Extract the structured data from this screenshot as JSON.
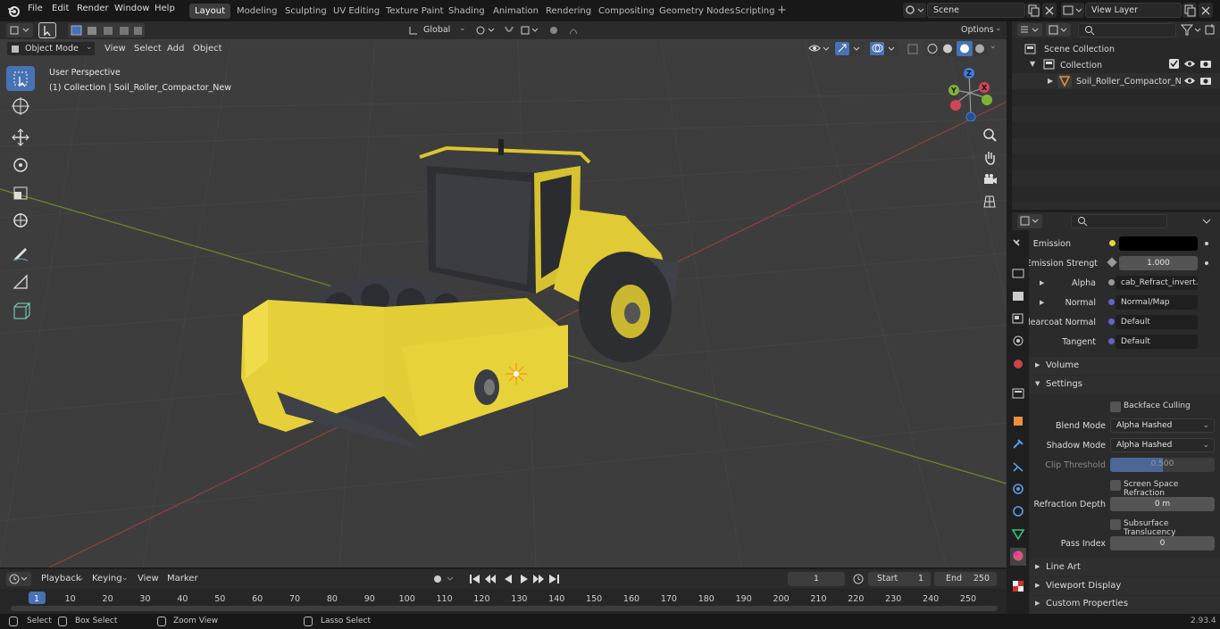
{
  "menubar": {
    "items": [
      "File",
      "Edit",
      "Render",
      "Window",
      "Help"
    ]
  },
  "workspaces": [
    "Layout",
    "Modeling",
    "Sculpting",
    "UV Editing",
    "Texture Paint",
    "Shading",
    "Animation",
    "Rendering",
    "Compositing",
    "Geometry Nodes",
    "Scripting"
  ],
  "active_workspace": "Layout",
  "scene": {
    "name": "Scene"
  },
  "view_layer": {
    "name": "View Layer"
  },
  "viewport_header": {
    "mode": "Object Mode",
    "menus": [
      "View",
      "Select",
      "Add",
      "Object"
    ],
    "transform_orientation": "Global",
    "options": "Options"
  },
  "viewport": {
    "overlay_line1": "User Perspective",
    "overlay_line2": "(1) Collection | Soil_Roller_Compactor_New",
    "gizmo": {
      "x": "X",
      "y": "Y",
      "z": "Z"
    }
  },
  "outliner": {
    "scene_collection": "Scene Collection",
    "collection": "Collection",
    "object": "Soil_Roller_Compactor_N"
  },
  "properties": {
    "rows": [
      {
        "label": "Emission",
        "value": "",
        "kind": "color"
      },
      {
        "label": "Emission Strengt",
        "value": "1.000",
        "kind": "number"
      },
      {
        "label": "Alpha",
        "value": "cab_Refract_invert.p...",
        "kind": "link"
      },
      {
        "label": "Normal",
        "value": "Normal/Map",
        "kind": "link"
      },
      {
        "label": "Clearcoat Normal",
        "value": "Default",
        "kind": "link"
      },
      {
        "label": "Tangent",
        "value": "Default",
        "kind": "link"
      }
    ],
    "sections": {
      "volume": "Volume",
      "settings": "Settings",
      "line_art": "Line Art",
      "viewport_display": "Viewport Display",
      "custom_properties": "Custom Properties"
    },
    "settings": {
      "backface_culling": "Backface Culling",
      "blend_mode_label": "Blend Mode",
      "blend_mode": "Alpha Hashed",
      "shadow_mode_label": "Shadow Mode",
      "shadow_mode": "Alpha Hashed",
      "clip_threshold_label": "Clip Threshold",
      "clip_threshold": "0.500",
      "screen_space_refraction": "Screen Space Refraction",
      "refraction_depth_label": "Refraction Depth",
      "refraction_depth": "0 m",
      "subsurface_translucency": "Subsurface Translucency",
      "pass_index_label": "Pass Index",
      "pass_index": "0"
    }
  },
  "timeline": {
    "menus": [
      "Playback",
      "Keying",
      "View",
      "Marker"
    ],
    "current_frame": "1",
    "start_label": "Start",
    "start": "1",
    "end_label": "End",
    "end": "250",
    "ruler": [
      "1",
      "10",
      "20",
      "30",
      "40",
      "50",
      "60",
      "70",
      "80",
      "90",
      "100",
      "110",
      "120",
      "130",
      "140",
      "150",
      "160",
      "170",
      "180",
      "190",
      "200",
      "210",
      "220",
      "230",
      "240",
      "250"
    ]
  },
  "statusbar": {
    "select": "Select",
    "box_select": "Box Select",
    "zoom_view": "Zoom View",
    "lasso_select": "Lasso Select",
    "version": "2.93.4"
  },
  "colors": {
    "accent": "#4772b3",
    "machine_yellow": "#e8d23a",
    "x_axis": "#d04455",
    "y_axis": "#7fb236",
    "z_axis": "#3c7fd8"
  }
}
